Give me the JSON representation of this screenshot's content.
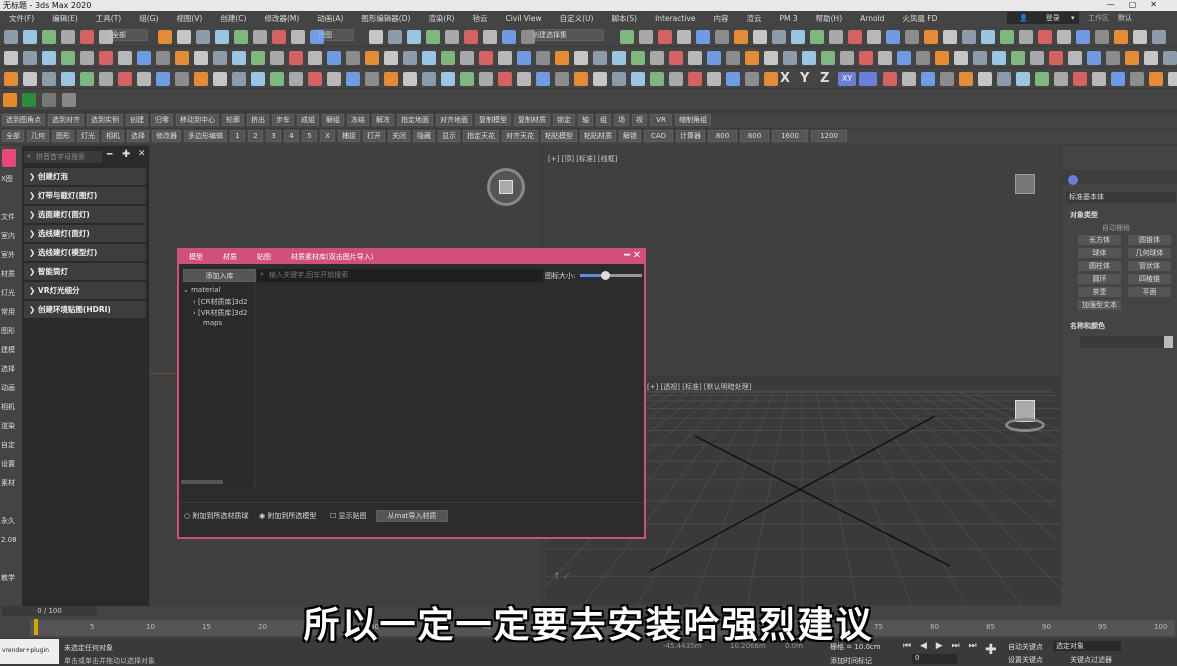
{
  "window": {
    "title": "无标题 - 3ds Max 2020"
  },
  "menu": [
    "文件(F)",
    "编辑(E)",
    "工具(T)",
    "组(G)",
    "视图(V)",
    "创建(C)",
    "修改器(M)",
    "动画(A)",
    "图形编辑器(D)",
    "渲染(R)",
    "毡云",
    "Civil View",
    "自定义(U)",
    "脚本(S)",
    "Interactive",
    "内容",
    "渲云",
    "PM 3",
    "帮助(H)",
    "Arnold",
    "火凤凰 FD"
  ],
  "login": {
    "label": "登录"
  },
  "workspace": {
    "label": "工作区",
    "value": "默认"
  },
  "toolbar1": {
    "filter": "全部",
    "view": "视图",
    "selset": "创建选择集"
  },
  "buttonrow1": [
    "选到图角点",
    "选到对齐",
    "选到实例",
    "创建",
    "归零",
    "移动到中心",
    "轮廓",
    "挤出",
    "步车",
    "成组",
    "解组",
    "冻结",
    "解冻",
    "指定地面",
    "对齐地面",
    "复制模型",
    "复制材质",
    "锁定",
    "轴",
    "组",
    "场",
    "视",
    "VR",
    "缩制角组"
  ],
  "buttonrow2": [
    "全部",
    "几何",
    "图形",
    "灯光",
    "相机",
    "选择",
    "修改器",
    "多边形编辑",
    "1",
    "2",
    "3",
    "4",
    "5",
    "X",
    "捕捉",
    "打开",
    "关闭",
    "隐藏",
    "显示",
    "指定天花",
    "对齐天花",
    "粘贴模型",
    "粘贴材质",
    "解锁",
    "CAD",
    "计算器",
    "800",
    "600",
    "1600",
    "1200"
  ],
  "leftrail": [
    "X图",
    "",
    "文件",
    "室内",
    "室外",
    "材质",
    "灯光",
    "常用",
    "图形",
    "建模",
    "选择",
    "动画",
    "相机",
    "渲染",
    "自定",
    "设置",
    "素材",
    "",
    "永久",
    "2.08",
    "",
    "教学"
  ],
  "leftpanel": {
    "search_placeholder": "拼音首字母搜索",
    "items": [
      "创建灯泡",
      "灯带与截灯(图灯)",
      "选面建灯(面灯)",
      "选线建灯(面灯)",
      "选线建灯(模型灯)",
      "智能筒灯",
      "VR灯光细分",
      "创建环境贴图(HDRI)"
    ]
  },
  "viewport": {
    "label": "[+] [顶] [标准] [线框]",
    "persp_label": "[+] [透视] [标准] [默认明暗处理]"
  },
  "dialog": {
    "tabs": [
      "模型",
      "材质",
      "贴图",
      "材质素材库(双击图片导入)"
    ],
    "add_button": "添加入库",
    "search_placeholder": "输入关键字,回车开始搜索",
    "icon_size_label": "图标大小:",
    "icon_size_value": 0.4,
    "tree": [
      "material",
      "[CR材质库]3d2",
      "[VR材质库]3d2",
      "maps"
    ],
    "options": [
      "附加到所选材质球",
      "附加到所选模型",
      "显示贴图"
    ],
    "import_button": "从mat导入材质"
  },
  "rightpanel": {
    "category": "标准基本体",
    "section1": "对象类型",
    "autogrid": "自动栅格",
    "objects": [
      "长方体",
      "圆锥体",
      "球体",
      "几何球体",
      "圆柱体",
      "管状体",
      "圆环",
      "四棱锥",
      "茶壶",
      "平面",
      "加强型文本"
    ],
    "section2": "名称和颜色"
  },
  "timeline": {
    "frame": "0 / 100",
    "ticks": [
      "0",
      "5",
      "10",
      "15",
      "20",
      "25",
      "30",
      "35",
      "40",
      "45",
      "50",
      "55",
      "60",
      "65",
      "70",
      "75",
      "80",
      "85",
      "90",
      "95",
      "100"
    ]
  },
  "status": {
    "script": "vrender+plugin",
    "line1": "未选定任何对象",
    "line2": "单击或单击并拖动以选择对象",
    "x": "-45.4435m",
    "y": "10.2066m",
    "z": "0.0m",
    "grid": "栅格 = 10.0cm",
    "add_time": "添加时间标记",
    "autokey": "自动关键点",
    "keymode": "选定对象",
    "setkey": "设置关键点",
    "keyfilter": "关键点过滤器",
    "frame": "0"
  },
  "subtitle": "所以一定一定要去安装哈强烈建议"
}
